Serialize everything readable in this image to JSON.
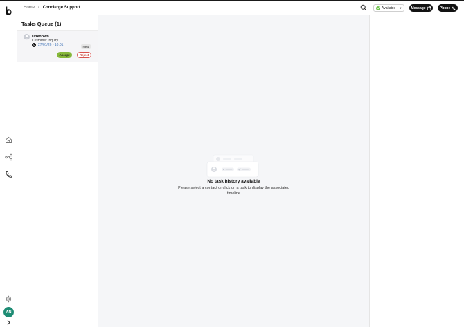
{
  "rail": {
    "avatar_initials": "AN"
  },
  "header": {
    "breadcrumb": {
      "home": "Home",
      "separator": "/",
      "current": "Concierge Support"
    },
    "status": {
      "label": "Available",
      "color": "#6cc24a"
    },
    "message_label": "Message",
    "phone_label": "Phone"
  },
  "queue": {
    "title": "Tasks Queue (1)",
    "tasks": [
      {
        "name": "Unknown",
        "subject": "Customer Inquiry",
        "time": "27/01/26 - 10:01",
        "badge": "New",
        "accept_label": "Accept",
        "reject_label": "Reject"
      }
    ]
  },
  "main": {
    "empty_title": "No task history available",
    "empty_text": "Please select a contact or click on a task to display the associated timeline"
  },
  "colors": {
    "accept": "#86b83a",
    "reject": "#d9534f",
    "avatar": "#1e8c74"
  }
}
